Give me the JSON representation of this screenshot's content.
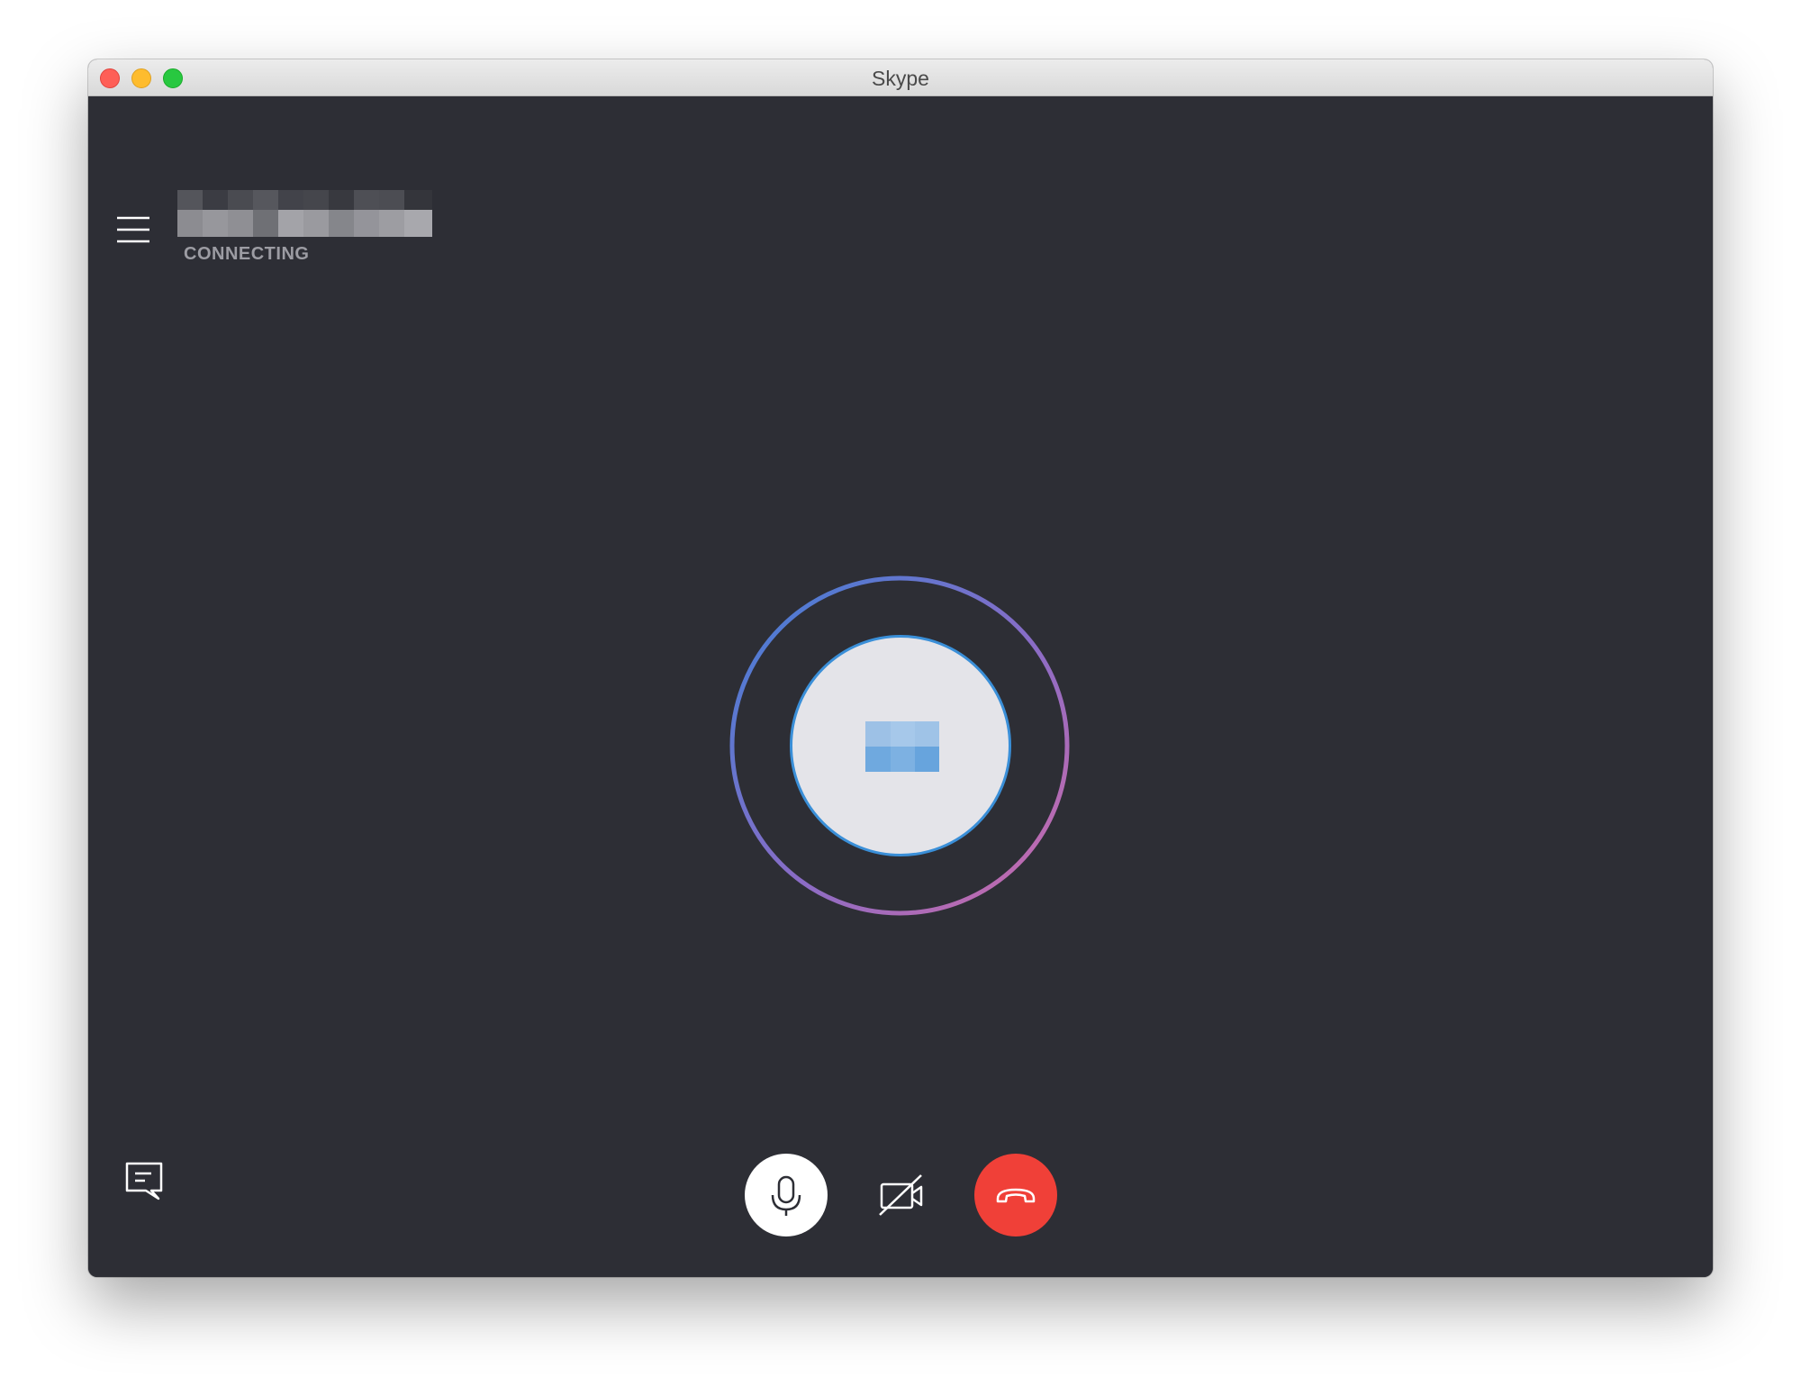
{
  "window": {
    "title": "Skype"
  },
  "call": {
    "status": "CONNECTING"
  },
  "icons": {
    "menu": "hamburger-menu-icon",
    "chat": "chat-icon",
    "mic": "microphone-icon",
    "video": "video-off-icon",
    "end": "end-call-icon"
  },
  "colors": {
    "background": "#2d2e35",
    "end_call": "#f04038",
    "ring_start": "#3f7fd6",
    "ring_end": "#c46bb2",
    "avatar_border": "#3a8fd8"
  }
}
